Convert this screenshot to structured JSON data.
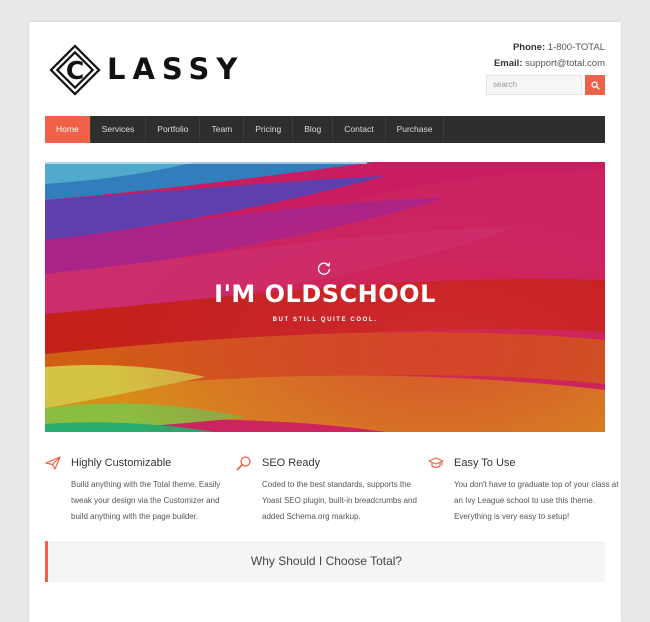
{
  "brand": {
    "name": "LASSY",
    "logo_letter": "C"
  },
  "contact": {
    "phone_label": "Phone:",
    "phone": "1-800-TOTAL",
    "email_label": "Email:",
    "email": "support@total.com"
  },
  "search": {
    "placeholder": "search"
  },
  "nav": {
    "items": [
      "Home",
      "Services",
      "Portfolio",
      "Team",
      "Pricing",
      "Blog",
      "Contact",
      "Purchase"
    ],
    "active": "Home"
  },
  "hero": {
    "title": "I'M OLDSCHOOL",
    "subtitle": "BUT STILL QUITE COOL.",
    "progress": 0.575
  },
  "features": [
    {
      "title": "Highly Customizable",
      "icon": "paper-plane-icon",
      "text": "Build anything with the Total theme. Easily tweak your design via the Customizer and build anything with the page builder."
    },
    {
      "title": "SEO Ready",
      "icon": "search-icon",
      "text": "Coded to the best standards, supports the Yoast SEO plugin, built-in breadcrumbs and added Schema.org markup."
    },
    {
      "title": "Easy To Use",
      "icon": "graduation-cap-icon",
      "text": "You don't have to graduate top of your class at an Ivy League school to use this theme. Everything is very easy to setup!"
    }
  ],
  "callout": {
    "text": "Why Should I Choose Total?"
  },
  "colors": {
    "accent": "#f0614a",
    "nav_bg": "#2e2e2e",
    "hero_bg": "#ea2a6f"
  }
}
